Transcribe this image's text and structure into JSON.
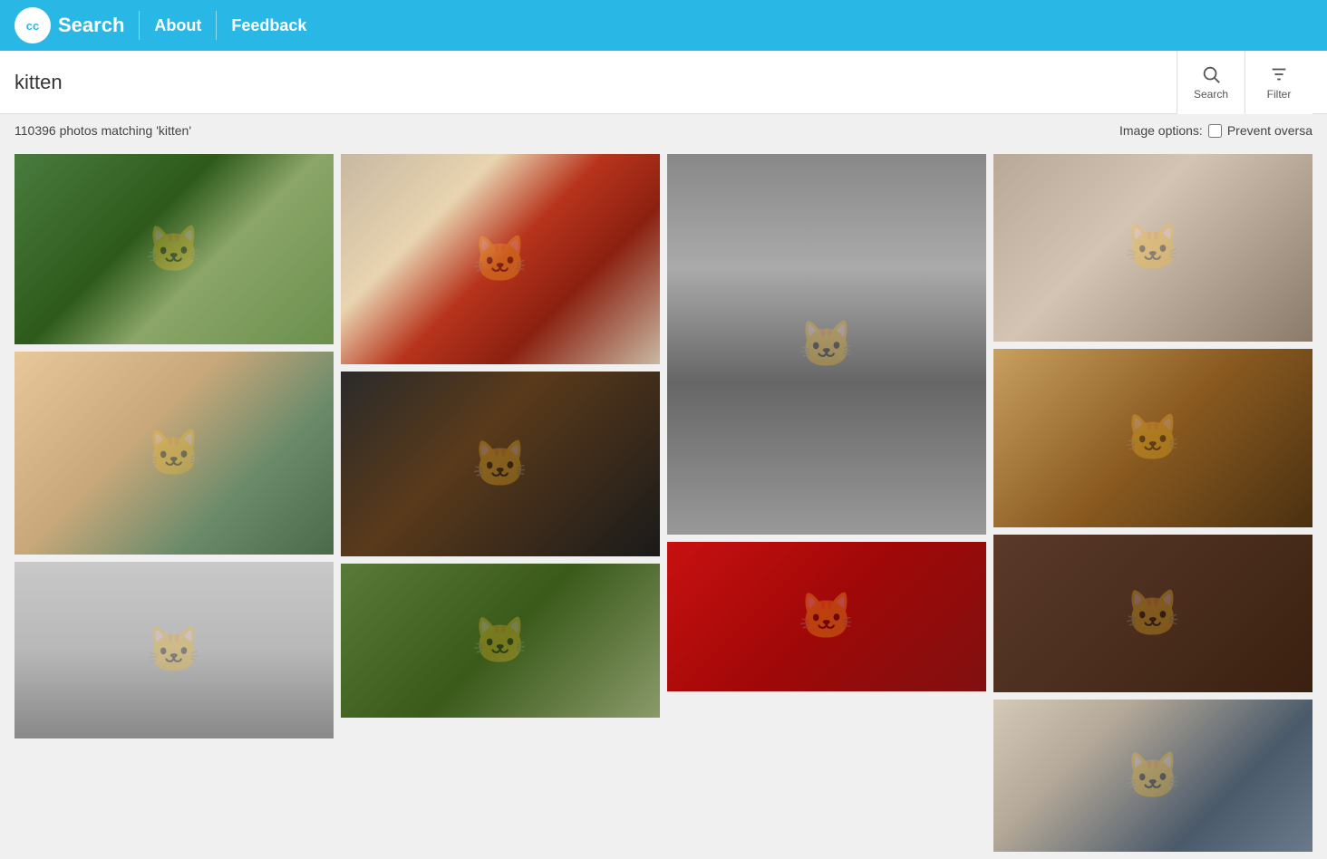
{
  "header": {
    "logo_text": "Search",
    "cc_text": "cc",
    "about_label": "About",
    "feedback_label": "Feedback"
  },
  "search": {
    "query": "kitten",
    "search_button_label": "Search",
    "filter_button_label": "Filter"
  },
  "results": {
    "count_text": "110396 photos matching 'kitten'",
    "image_options_label": "Image options:",
    "prevent_label": "Prevent oversa"
  },
  "images": [
    {
      "id": 1,
      "alt": "Kitten in green leaves",
      "cls": "img1"
    },
    {
      "id": 2,
      "alt": "Kitten on rug",
      "cls": "img2"
    },
    {
      "id": 3,
      "alt": "Kitten black and white tall",
      "cls": "img3"
    },
    {
      "id": 4,
      "alt": "Kitten portrait close up",
      "cls": "img4"
    },
    {
      "id": 5,
      "alt": "Orange kitten held",
      "cls": "img5"
    },
    {
      "id": 6,
      "alt": "Dark kitten close up",
      "cls": "img6"
    },
    {
      "id": 7,
      "alt": "Kitten on road",
      "cls": "img7"
    },
    {
      "id": 8,
      "alt": "Kitten in box",
      "cls": "img8"
    },
    {
      "id": 9,
      "alt": "Dark colored kitten close",
      "cls": "img9"
    },
    {
      "id": 10,
      "alt": "Kitten on red",
      "cls": "img10"
    },
    {
      "id": 11,
      "alt": "Kittens outdoors",
      "cls": "img11"
    },
    {
      "id": 12,
      "alt": "Girl with kitten",
      "cls": "img12"
    }
  ]
}
